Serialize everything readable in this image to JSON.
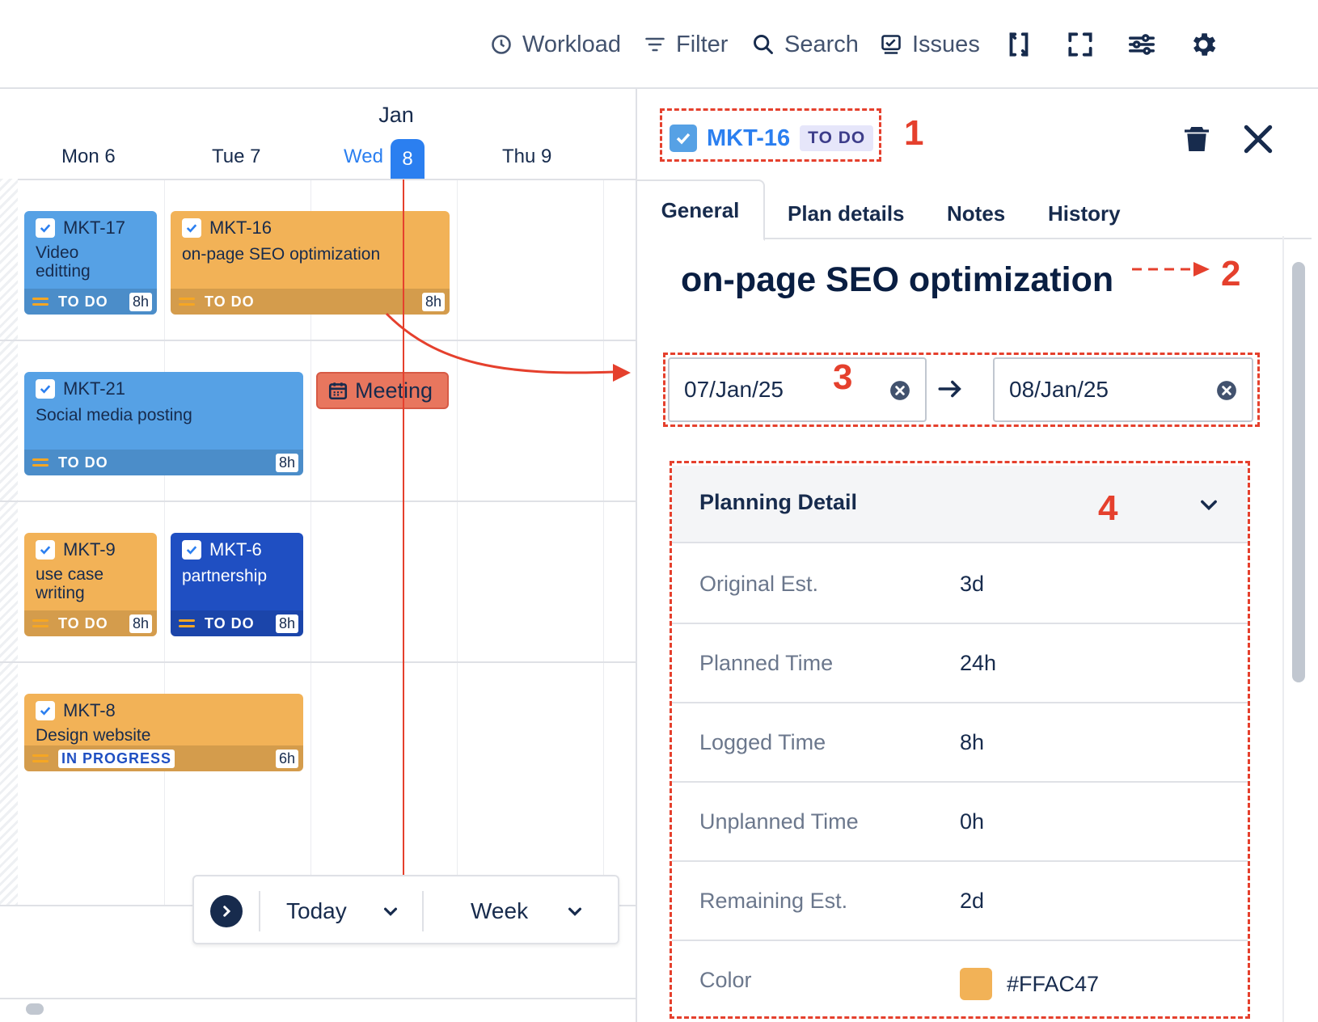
{
  "toolbar": {
    "workload": "Workload",
    "filter": "Filter",
    "search": "Search",
    "issues": "Issues"
  },
  "calendar": {
    "month": "Jan",
    "days": [
      {
        "label": "Mon 6"
      },
      {
        "label": "Tue 7"
      },
      {
        "label": "Wed"
      },
      {
        "label": "Thu 9"
      }
    ],
    "today_number": "8",
    "cards": [
      {
        "key": "MKT-17",
        "title": "Video\neditting",
        "status": "TO DO",
        "hours": "8h",
        "color": "blue"
      },
      {
        "key": "MKT-16",
        "title": "on-page SEO optimization",
        "status": "TO DO",
        "hours": "8h",
        "color": "orange"
      },
      {
        "key": "MKT-21",
        "title": "Social media posting",
        "status": "TO DO",
        "hours": "8h",
        "color": "blue"
      },
      {
        "key": "MKT-9",
        "title": "use case\nwriting",
        "status": "TO DO",
        "hours": "8h",
        "color": "orange"
      },
      {
        "key": "MKT-6",
        "title": "partnership",
        "status": "TO DO",
        "hours": "8h",
        "color": "darkblue"
      },
      {
        "key": "MKT-8",
        "title": "Design website",
        "status": "IN PROGRESS",
        "hours": "6h",
        "color": "orange"
      }
    ],
    "meeting": "Meeting",
    "nav": {
      "today": "Today",
      "view": "Week"
    }
  },
  "panel": {
    "issue_key": "MKT-16",
    "status": "TO DO",
    "tabs": [
      "General",
      "Plan details",
      "Notes",
      "History"
    ],
    "title": "on-page SEO optimization",
    "start_date": "07/Jan/25",
    "end_date": "08/Jan/25",
    "planning": {
      "header": "Planning Detail",
      "rows": [
        {
          "label": "Original Est.",
          "value": "3d"
        },
        {
          "label": "Planned Time",
          "value": "24h"
        },
        {
          "label": "Logged Time",
          "value": "8h"
        },
        {
          "label": "Unplanned Time",
          "value": "0h"
        },
        {
          "label": "Remaining Est.",
          "value": "2d"
        },
        {
          "label": "Color",
          "value": "#FFAC47"
        }
      ]
    }
  },
  "annotations": [
    "1",
    "2",
    "3",
    "4"
  ],
  "colors": {
    "accent": "#2b7ff0",
    "card_blue": "#56a1e5",
    "card_orange": "#f2b257",
    "card_darkblue": "#1f4fc2",
    "annotation": "#e5402d",
    "swatch": "#FFAC47"
  },
  "icons": [
    "clock-icon",
    "filter-icon",
    "search-icon",
    "issues-icon",
    "sync-icon",
    "fullscreen-icon",
    "sliders-icon",
    "gear-icon",
    "trash-icon",
    "close-icon",
    "calendar-icon",
    "check-icon",
    "chevron-down-icon",
    "chevron-right-icon",
    "arrow-right-icon",
    "clear-icon"
  ]
}
